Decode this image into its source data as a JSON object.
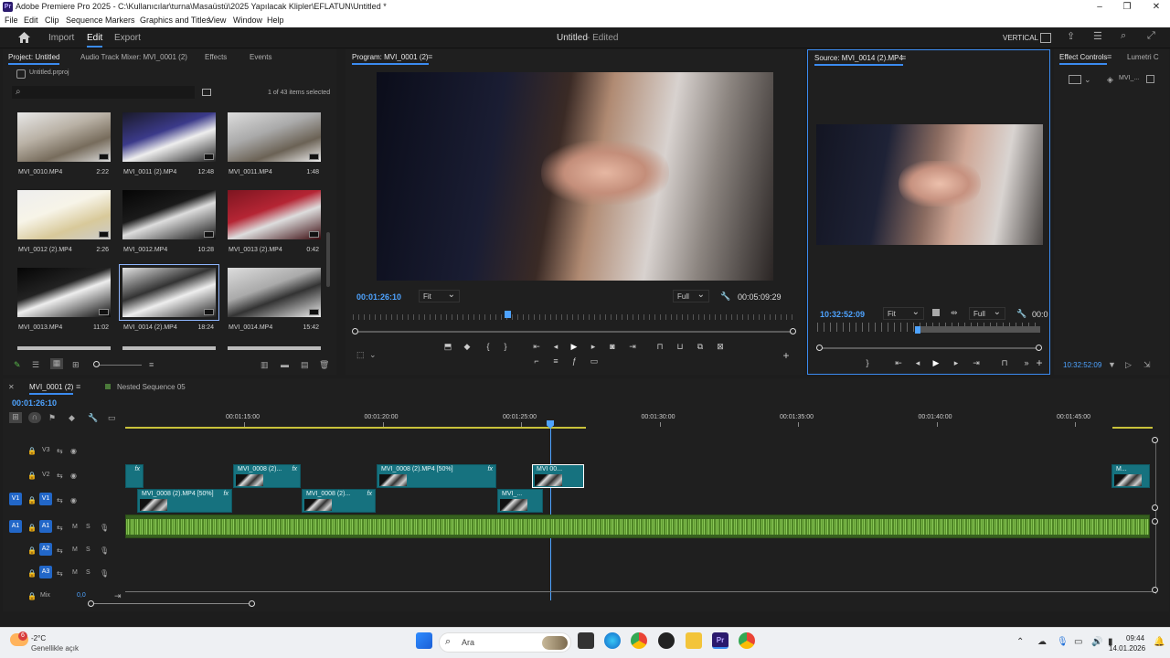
{
  "window": {
    "title": "Adobe Premiere Pro 2025 - C:\\Kullanıcılar\\turna\\Masaüstü\\2025 Yapılacak Klipler\\EFLATUN\\Untitled *",
    "app_icon": "Pr"
  },
  "menu": [
    "File",
    "Edit",
    "Clip",
    "Sequence",
    "Markers",
    "Graphics and Titles",
    "View",
    "Window",
    "Help"
  ],
  "header": {
    "workspaces": [
      "Import",
      "Edit",
      "Export"
    ],
    "active": "Edit",
    "project_title": "Untitled",
    "status": "- Edited",
    "right_label": "VERTICAL"
  },
  "project_panel": {
    "tabs": [
      "Project: Untitled",
      "Audio Track Mixer: MVI_0001 (2)",
      "Effects",
      "Events"
    ],
    "file": "Untitled.prproj",
    "selection": "1 of 43 items selected",
    "items": [
      {
        "name": "MVI_0010.MP4",
        "dur": "2:22"
      },
      {
        "name": "MVI_0011 (2).MP4",
        "dur": "12:48"
      },
      {
        "name": "MVI_0011.MP4",
        "dur": "1:48"
      },
      {
        "name": "MVI_0012 (2).MP4",
        "dur": "2:26"
      },
      {
        "name": "MVI_0012.MP4",
        "dur": "10:28"
      },
      {
        "name": "MVI_0013 (2).MP4",
        "dur": "0:42"
      },
      {
        "name": "MVI_0013.MP4",
        "dur": "11:02"
      },
      {
        "name": "MVI_0014 (2).MP4",
        "dur": "18:24"
      },
      {
        "name": "MVI_0014.MP4",
        "dur": "15:42"
      }
    ],
    "selected_index": 7
  },
  "program": {
    "tab": "Program: MVI_0001 (2)",
    "timecode": "00:01:26:10",
    "fit": "Fit",
    "quality": "Full",
    "duration": "00:05:09:29",
    "playhead": 0.35
  },
  "source": {
    "tab": "Source: MVI_0014 (2).MP4",
    "timecode": "10:32:52:09",
    "fit": "Fit",
    "quality": "Full",
    "duration_partial": "00:0",
    "playhead": 0.45
  },
  "effect_controls": {
    "tabs": [
      "Effect Controls",
      "Lumetri C"
    ],
    "clip": "MVI_...",
    "timecode": "10:32:52:09"
  },
  "timeline": {
    "tabs": [
      "MVI_0001 (2)",
      "Nested Sequence 05"
    ],
    "timecode": "00:01:26:10",
    "ruler": [
      "00:01:15:00",
      "00:01:20:00",
      "00:01:25:00",
      "00:01:30:00",
      "00:01:35:00",
      "00:01:40:00",
      "00:01:45:00"
    ],
    "video_tracks": [
      "V3",
      "V2",
      "V1"
    ],
    "audio_tracks": [
      "A1",
      "A2",
      "A3"
    ],
    "mix_label": "Mix",
    "mix_value": "0,0",
    "clips_v2": [
      "MVI_0008 (2)...",
      "MVI_0008 (2).MP4 [50%]",
      "MVI 00...",
      "M..."
    ],
    "clips_v1": [
      "MVI_0008 (2).MP4 [50%]",
      "MVI_0008 (2)...",
      "MVI_..."
    ],
    "fx_label": "fx"
  },
  "taskbar": {
    "weather_temp": "-2°C",
    "weather_desc": "Genellikle açık",
    "search": "Ara",
    "time": "09:44",
    "date": "14.01.2026",
    "badge": "6"
  }
}
